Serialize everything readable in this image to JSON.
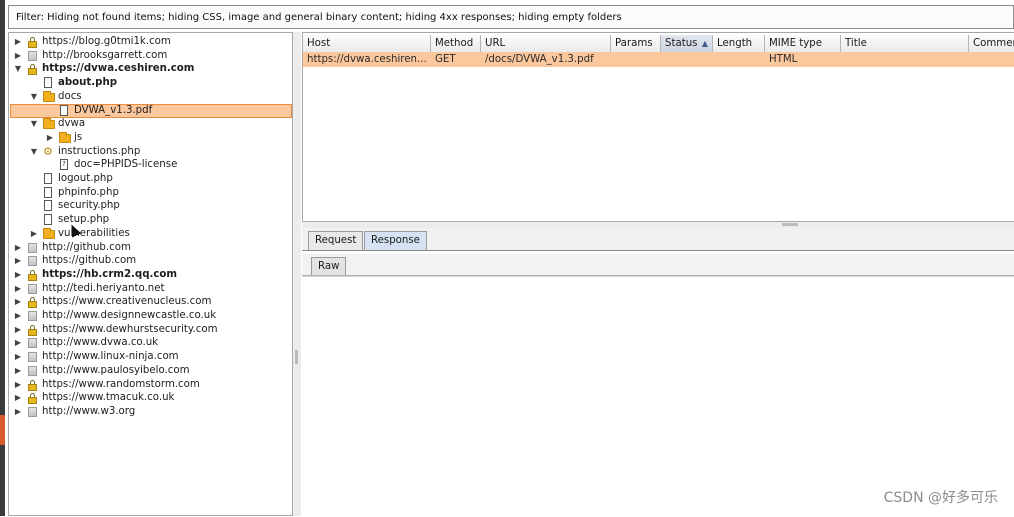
{
  "filter": {
    "text": "Filter: Hiding not found items;  hiding CSS, image and general binary content;  hiding 4xx responses;  hiding empty folders"
  },
  "tree": {
    "items": [
      {
        "label": "https://blog.g0tmi1k.com",
        "icon": "lock-icon",
        "twisty": "▶",
        "bold": false,
        "indent": 0
      },
      {
        "label": "http://brooksgarrett.com",
        "icon": "globe-icon",
        "twisty": "▶",
        "bold": false,
        "indent": 0
      },
      {
        "label": "https://dvwa.ceshiren.com",
        "icon": "lock-icon",
        "twisty": "▼",
        "bold": true,
        "indent": 0
      },
      {
        "label": "about.php",
        "icon": "file-icon",
        "twisty": "",
        "bold": true,
        "indent": 1
      },
      {
        "label": "docs",
        "icon": "folder-icon",
        "twisty": "▼",
        "bold": false,
        "indent": 1
      },
      {
        "label": "DVWA_v1.3.pdf",
        "icon": "file-icon",
        "twisty": "",
        "bold": false,
        "indent": 2,
        "selected": true
      },
      {
        "label": "dvwa",
        "icon": "folder-icon",
        "twisty": "▼",
        "bold": false,
        "indent": 1
      },
      {
        "label": "js",
        "icon": "folder-icon",
        "twisty": "▶",
        "bold": false,
        "indent": 2
      },
      {
        "label": "instructions.php",
        "icon": "gear-icon",
        "twisty": "▼",
        "bold": false,
        "indent": 1
      },
      {
        "label": "doc=PHPIDS-license",
        "icon": "param-file-icon",
        "twisty": "",
        "bold": false,
        "indent": 2
      },
      {
        "label": "logout.php",
        "icon": "file-icon",
        "twisty": "",
        "bold": false,
        "indent": 1
      },
      {
        "label": "phpinfo.php",
        "icon": "file-icon",
        "twisty": "",
        "bold": false,
        "indent": 1
      },
      {
        "label": "security.php",
        "icon": "file-icon",
        "twisty": "",
        "bold": false,
        "indent": 1
      },
      {
        "label": "setup.php",
        "icon": "file-icon",
        "twisty": "",
        "bold": false,
        "indent": 1
      },
      {
        "label": "vulnerabilities",
        "icon": "folder-icon",
        "twisty": "▶",
        "bold": false,
        "indent": 1
      },
      {
        "label": "http://github.com",
        "icon": "globe-icon",
        "twisty": "▶",
        "bold": false,
        "indent": 0
      },
      {
        "label": "https://github.com",
        "icon": "globe-icon",
        "twisty": "▶",
        "bold": false,
        "indent": 0
      },
      {
        "label": "https://hb.crm2.qq.com",
        "icon": "lock-icon",
        "twisty": "▶",
        "bold": true,
        "indent": 0
      },
      {
        "label": "http://tedi.heriyanto.net",
        "icon": "globe-icon",
        "twisty": "▶",
        "bold": false,
        "indent": 0
      },
      {
        "label": "https://www.creativenucleus.com",
        "icon": "lock-icon",
        "twisty": "▶",
        "bold": false,
        "indent": 0
      },
      {
        "label": "http://www.designnewcastle.co.uk",
        "icon": "globe-icon",
        "twisty": "▶",
        "bold": false,
        "indent": 0
      },
      {
        "label": "https://www.dewhurstsecurity.com",
        "icon": "lock-icon",
        "twisty": "▶",
        "bold": false,
        "indent": 0
      },
      {
        "label": "http://www.dvwa.co.uk",
        "icon": "globe-icon",
        "twisty": "▶",
        "bold": false,
        "indent": 0
      },
      {
        "label": "http://www.linux-ninja.com",
        "icon": "globe-icon",
        "twisty": "▶",
        "bold": false,
        "indent": 0
      },
      {
        "label": "http://www.paulosyibelo.com",
        "icon": "globe-icon",
        "twisty": "▶",
        "bold": false,
        "indent": 0
      },
      {
        "label": "https://www.randomstorm.com",
        "icon": "lock-icon",
        "twisty": "▶",
        "bold": false,
        "indent": 0
      },
      {
        "label": "https://www.tmacuk.co.uk",
        "icon": "lock-icon",
        "twisty": "▶",
        "bold": false,
        "indent": 0
      },
      {
        "label": "http://www.w3.org",
        "icon": "globe-icon",
        "twisty": "▶",
        "bold": false,
        "indent": 0
      }
    ]
  },
  "table": {
    "columns": [
      "Host",
      "Method",
      "URL",
      "Params",
      "Status",
      "Length",
      "MIME type",
      "Title",
      "Comment"
    ],
    "sorted_column": "Status",
    "sort_icon": "▲",
    "rows": [
      {
        "Host": "https://dvwa.ceshiren...",
        "Method": "GET",
        "URL": "/docs/DVWA_v1.3.pdf",
        "Params": "",
        "Status": "",
        "Length": "",
        "MIME type": "HTML",
        "Title": "",
        "Comment": ""
      }
    ]
  },
  "tabs": {
    "request": "Request",
    "response": "Response",
    "active": "Response"
  },
  "subtab": {
    "raw": "Raw"
  },
  "watermark": "CSDN @好多可乐",
  "colors": {
    "selection": "#fbc79c",
    "selection_border": "#e98c3e",
    "active_tab": "#d6e2f2"
  }
}
